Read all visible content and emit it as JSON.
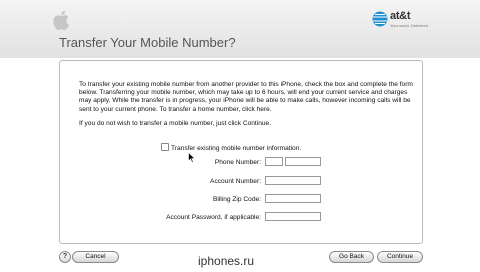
{
  "header": {
    "title": "Transfer Your Mobile Number?",
    "carrier_name": "at&t",
    "carrier_tagline": "Your world. Delivered",
    "logo_icon": "apple-logo-icon"
  },
  "body": {
    "paragraph1": "To transfer your existing mobile number from another provider to this iPhone, check the box and complete the form below. Transferring your mobile number, which may take up to 6 hours, will end your current service and charges may apply. While the transfer is in progress, your iPhone will be able to make calls, however incoming calls will be sent to your current phone. To transfer a home number, click here.",
    "paragraph2": "If you do not wish to transfer a mobile number, just click Continue.",
    "checkbox_label": "Transfer existing mobile number information.",
    "fields": {
      "phone": "Phone Number:",
      "account": "Account Number:",
      "zip": "Billing Zip Code:",
      "password": "Account Password, if applicable:"
    }
  },
  "footer": {
    "help": "?",
    "cancel": "Cancel",
    "back": "Go Back",
    "continue": "Continue",
    "watermark": "iphones.ru"
  }
}
